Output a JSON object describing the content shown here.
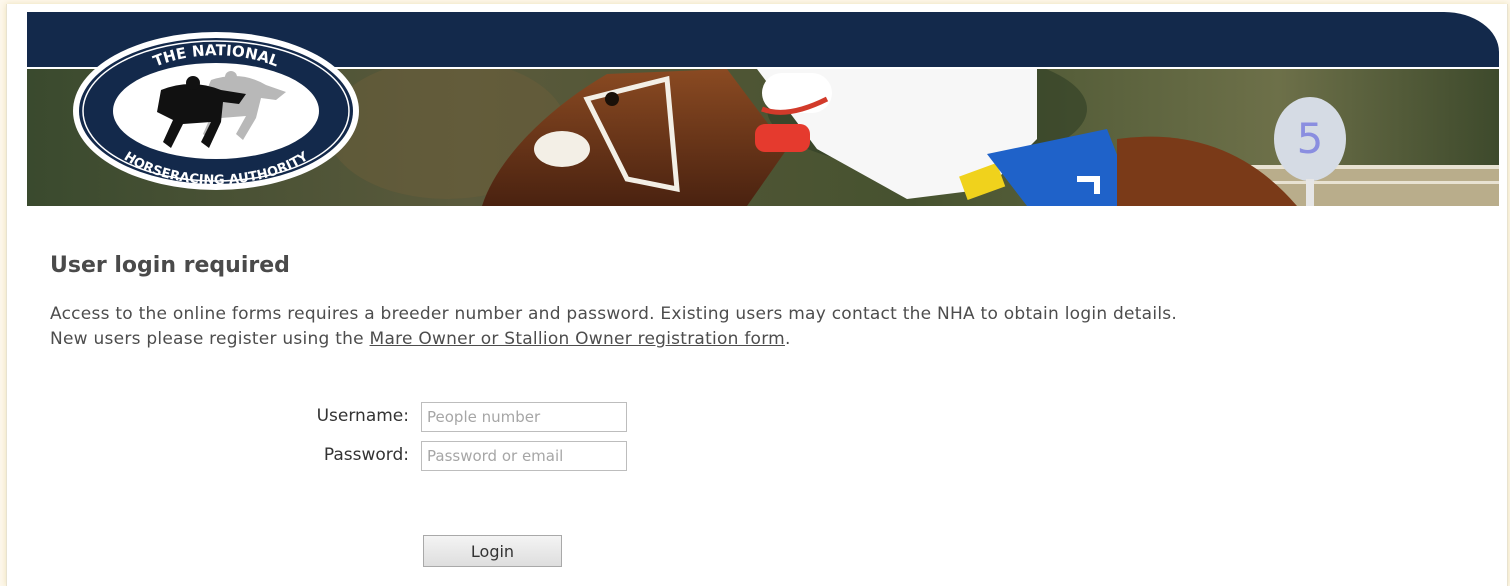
{
  "header": {
    "logo_top_text": "THE NATIONAL",
    "logo_bottom_text": "HORSERACING AUTHORITY",
    "marker_post_number": "5"
  },
  "main": {
    "heading": "User login required",
    "intro_line1": "Access to the online forms requires a breeder number and password. Existing users may contact the NHA to obtain login details.",
    "intro_line2_prefix": "New users please register using the ",
    "intro_link": "Mare Owner or Stallion Owner registration form",
    "intro_line2_suffix": "."
  },
  "form": {
    "username_label": "Username:",
    "username_placeholder": "People number",
    "username_value": "",
    "password_label": "Password:",
    "password_placeholder": "Password or email",
    "password_value": "",
    "login_label": "Login"
  },
  "colors": {
    "header_navy": "#13294b",
    "text_gray": "#4d4d4d",
    "page_background": "#fdf8ec"
  }
}
